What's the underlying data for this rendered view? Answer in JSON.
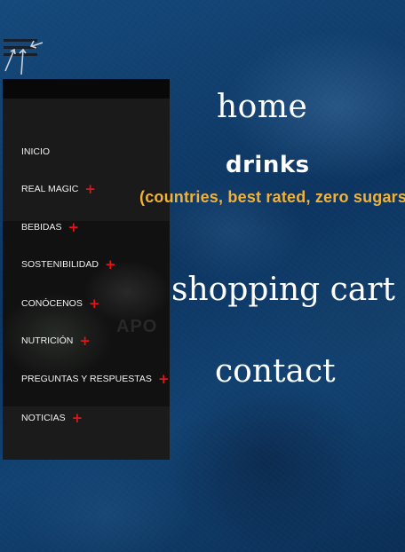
{
  "side_menu": {
    "items": [
      {
        "label": "INICIO",
        "expandable": false
      },
      {
        "label": "REAL MAGIC",
        "expandable": true
      },
      {
        "label": "BEBIDAS",
        "expandable": true
      },
      {
        "label": "SOSTENIBILIDAD",
        "expandable": true
      },
      {
        "label": "CONÓCENOS",
        "expandable": true
      },
      {
        "label": "NUTRICIÓN",
        "expandable": true
      },
      {
        "label": "PREGUNTAS Y RESPUESTAS",
        "expandable": true
      },
      {
        "label": "NOTICIAS",
        "expandable": true
      }
    ],
    "expand_glyph": "+",
    "background_photo_text": "APO"
  },
  "main_nav": {
    "home": "home",
    "drinks": "drinks",
    "drinks_subtitle": "(countries, best rated, zero sugars)",
    "shopping_cart": "shopping cart",
    "contact": "contact"
  },
  "icons": {
    "menu": "hamburger-menu-icon",
    "expand": "plus-icon"
  },
  "colors": {
    "background": "#0f3a64",
    "panel": "#1a1a1a",
    "plus": "#e01419",
    "subtitle": "#f0b23a",
    "nav_text": "#ffffff"
  }
}
